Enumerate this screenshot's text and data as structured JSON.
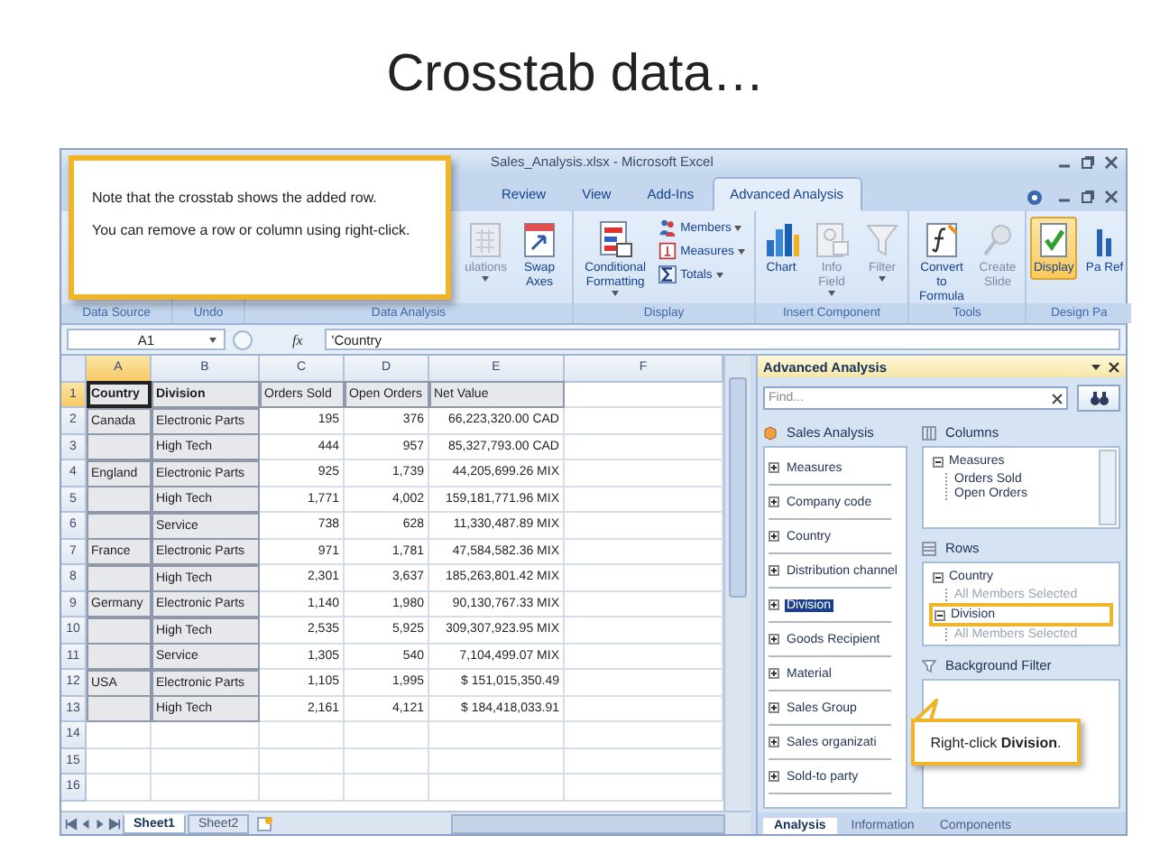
{
  "slide_title": "Crosstab data…",
  "window": {
    "title": "Sales_Analysis.xlsx - Microsoft Excel"
  },
  "ribbon_tabs": [
    {
      "label": "Review",
      "selected": false
    },
    {
      "label": "View",
      "selected": false
    },
    {
      "label": "Add-Ins",
      "selected": false
    },
    {
      "label": "Advanced Analysis",
      "selected": true
    }
  ],
  "ribbon_groups": [
    {
      "label": "Data Source"
    },
    {
      "label": "Undo"
    },
    {
      "label": "Data Analysis",
      "buttons": [
        {
          "label": "ulations",
          "kind": "large",
          "disabled": true,
          "dropdown": true,
          "pressed": false
        },
        {
          "label": "Swap Axes",
          "kind": "large",
          "disabled": false,
          "dropdown": false,
          "pressed": false
        }
      ]
    },
    {
      "label": "Display",
      "buttons": [
        {
          "label": "Conditional Formatting",
          "kind": "large",
          "disabled": false,
          "dropdown": true,
          "pressed": false
        },
        {
          "label": "Members",
          "kind": "small",
          "disabled": false,
          "dropdown": true,
          "pressed": false
        },
        {
          "label": "Measures",
          "kind": "small",
          "disabled": false,
          "dropdown": true,
          "pressed": false
        },
        {
          "label": "Totals",
          "kind": "small",
          "disabled": false,
          "dropdown": true,
          "pressed": false
        }
      ]
    },
    {
      "label": "Insert Component",
      "buttons": [
        {
          "label": "Chart",
          "kind": "large",
          "disabled": false,
          "dropdown": false,
          "pressed": false
        },
        {
          "label": "Info Field",
          "kind": "large",
          "disabled": true,
          "dropdown": true,
          "pressed": false
        },
        {
          "label": "Filter",
          "kind": "large",
          "disabled": true,
          "dropdown": true,
          "pressed": false
        }
      ]
    },
    {
      "label": "Tools",
      "buttons": [
        {
          "label": "Convert to Formula",
          "kind": "large",
          "disabled": false,
          "dropdown": false,
          "pressed": false
        },
        {
          "label": "Create Slide",
          "kind": "large",
          "disabled": true,
          "dropdown": false,
          "pressed": false
        }
      ]
    },
    {
      "label": "Design Pa",
      "buttons": [
        {
          "label": "Display",
          "kind": "large",
          "disabled": false,
          "dropdown": false,
          "pressed": true
        },
        {
          "label": "Pa Ref",
          "kind": "large",
          "disabled": false,
          "dropdown": false,
          "pressed": false
        }
      ]
    }
  ],
  "formula_bar": {
    "name_box": "A1",
    "function_label": "fx",
    "formula": "'Country"
  },
  "columns": [
    {
      "label": "A",
      "selected": true
    },
    {
      "label": "B",
      "selected": false
    },
    {
      "label": "C",
      "selected": false
    },
    {
      "label": "D",
      "selected": false
    },
    {
      "label": "E",
      "selected": false
    },
    {
      "label": "F",
      "selected": false
    }
  ],
  "rows": [
    {
      "number": "1",
      "kind": "header",
      "selected": true,
      "country": "Country",
      "division": "Division",
      "orders_sold": "Orders Sold",
      "open_orders": "Open Orders",
      "net_value": "Net Value"
    },
    {
      "number": "2",
      "kind": "data",
      "selected": false,
      "country": "Canada",
      "division": "Electronic Parts",
      "orders_sold": "195",
      "open_orders": "376",
      "net_value": "66,223,320.00 CAD"
    },
    {
      "number": "3",
      "kind": "data",
      "selected": false,
      "division": "High Tech",
      "orders_sold": "444",
      "open_orders": "957",
      "net_value": "85,327,793.00 CAD"
    },
    {
      "number": "4",
      "kind": "data",
      "selected": false,
      "country": "England",
      "division": "Electronic Parts",
      "orders_sold": "925",
      "open_orders": "1,739",
      "net_value": "44,205,699.26 MIX"
    },
    {
      "number": "5",
      "kind": "data",
      "selected": false,
      "division": "High Tech",
      "orders_sold": "1,771",
      "open_orders": "4,002",
      "net_value": "159,181,771.96 MIX"
    },
    {
      "number": "6",
      "kind": "data",
      "selected": false,
      "division": "Service",
      "orders_sold": "738",
      "open_orders": "628",
      "net_value": "11,330,487.89 MIX"
    },
    {
      "number": "7",
      "kind": "data",
      "selected": false,
      "country": "France",
      "division": "Electronic Parts",
      "orders_sold": "971",
      "open_orders": "1,781",
      "net_value": "47,584,582.36 MIX"
    },
    {
      "number": "8",
      "kind": "data",
      "selected": false,
      "division": "High Tech",
      "orders_sold": "2,301",
      "open_orders": "3,637",
      "net_value": "185,263,801.42 MIX"
    },
    {
      "number": "9",
      "kind": "data",
      "selected": false,
      "country": "Germany",
      "division": "Electronic Parts",
      "orders_sold": "1,140",
      "open_orders": "1,980",
      "net_value": "90,130,767.33 MIX"
    },
    {
      "number": "10",
      "kind": "data",
      "selected": false,
      "division": "High Tech",
      "orders_sold": "2,535",
      "open_orders": "5,925",
      "net_value": "309,307,923.95 MIX"
    },
    {
      "number": "11",
      "kind": "data",
      "selected": false,
      "division": "Service",
      "orders_sold": "1,305",
      "open_orders": "540",
      "net_value": "7,104,499.07 MIX"
    },
    {
      "number": "12",
      "kind": "data",
      "selected": false,
      "country": "USA",
      "division": "Electronic Parts",
      "orders_sold": "1,105",
      "open_orders": "1,995",
      "net_value": "$ 151,015,350.49"
    },
    {
      "number": "13",
      "kind": "data",
      "selected": false,
      "division": "High Tech",
      "orders_sold": "2,161",
      "open_orders": "4,121",
      "net_value": "$ 184,418,033.91"
    },
    {
      "number": "14",
      "kind": "empty",
      "selected": false
    },
    {
      "number": "15",
      "kind": "empty",
      "selected": false
    },
    {
      "number": "16",
      "kind": "empty",
      "selected": false
    }
  ],
  "sheet_tabs": [
    {
      "label": "Sheet1",
      "selected": true
    },
    {
      "label": "Sheet2",
      "selected": false
    }
  ],
  "pane": {
    "title": "Advanced Analysis",
    "find_placeholder": "Find...",
    "source": "Sales Analysis",
    "fields": [
      {
        "label": "Measures",
        "selected": false
      },
      {
        "label": "Company code",
        "selected": false
      },
      {
        "label": "Country",
        "selected": false
      },
      {
        "label": "Distribution channel",
        "selected": false
      },
      {
        "label": "Division",
        "selected": true
      },
      {
        "label": "Goods Recipient",
        "selected": false
      },
      {
        "label": "Material",
        "selected": false
      },
      {
        "label": "Sales Group",
        "selected": false
      },
      {
        "label": "Sales organizati",
        "selected": false
      },
      {
        "label": "Sold-to party",
        "selected": false
      }
    ],
    "columns_title": "Columns",
    "columns_tree": [
      {
        "label": "Measures",
        "expanded": true,
        "highlighted": false,
        "children": [
          {
            "label": "Orders Sold"
          },
          {
            "label": "Open Orders"
          }
        ]
      }
    ],
    "rows_title": "Rows",
    "rows_tree": [
      {
        "label": "Country",
        "expanded": true,
        "highlighted": false,
        "children": [
          {
            "label": "All Members Selected"
          }
        ]
      },
      {
        "label": "Division",
        "expanded": true,
        "highlighted": true,
        "children": [
          {
            "label": "All Members Selected"
          }
        ]
      }
    ],
    "filter_title": "Background Filter",
    "tabs": [
      {
        "label": "Analysis",
        "selected": true
      },
      {
        "label": "Information",
        "selected": false
      },
      {
        "label": "Components",
        "selected": false
      }
    ]
  },
  "callouts": [
    {
      "text": "Note that the crosstab shows the added row."
    },
    {
      "text": "You can remove a row or column using right-click."
    }
  ],
  "pointer_callout": {
    "text": "Right-click **Division**."
  }
}
